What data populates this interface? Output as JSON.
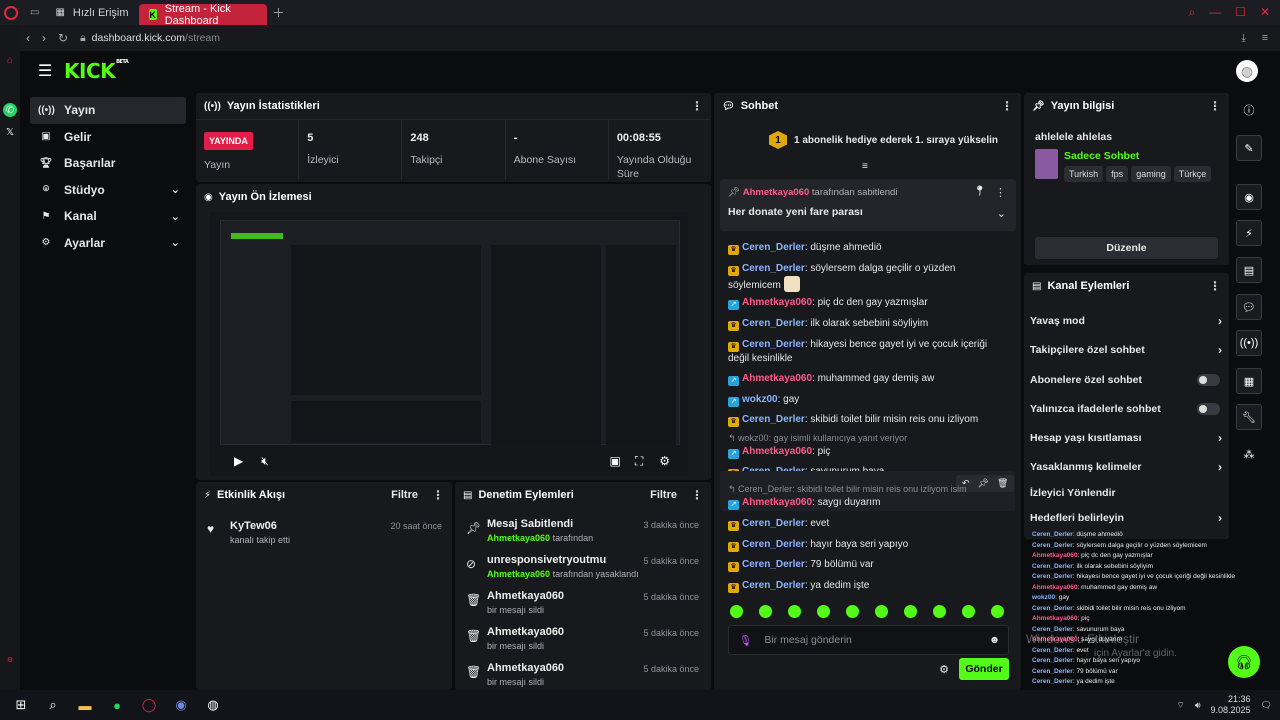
{
  "browser": {
    "tabs": [
      {
        "label": "Hızlı Erişim"
      },
      {
        "label": "Stream - Kick Dashboard"
      }
    ],
    "url_host": "dashboard.kick.com",
    "url_path": "/stream"
  },
  "header": {
    "logo": "KICK",
    "beta": "BETA"
  },
  "nav": [
    {
      "label": "Yayın",
      "icon": "broadcast-icon"
    },
    {
      "label": "Gelir",
      "icon": "wallet-icon"
    },
    {
      "label": "Başarılar",
      "icon": "trophy-icon"
    },
    {
      "label": "Stüdyo",
      "icon": "studio-icon"
    },
    {
      "label": "Kanal",
      "icon": "channel-icon"
    },
    {
      "label": "Ayarlar",
      "icon": "gear-icon"
    }
  ],
  "stats_panel": {
    "title": "Yayın İstatistikleri",
    "live_badge": "YAYINDA",
    "items": [
      {
        "label": "Yayın",
        "value": ""
      },
      {
        "label": "İzleyici",
        "value": "5"
      },
      {
        "label": "Takipçi",
        "value": "248"
      },
      {
        "label": "Abone Sayısı",
        "value": "-"
      },
      {
        "label": "Yayında Olduğu Süre",
        "value": "00:08:55"
      }
    ]
  },
  "preview_panel": {
    "title": "Yayın Ön İzlemesi"
  },
  "activity_panel": {
    "title": "Etkinlik Akışı",
    "filter": "Filtre",
    "events": [
      {
        "user": "KyTew06",
        "desc": "kanalı takip etti",
        "time": "20 saat önce"
      }
    ]
  },
  "moderation_panel": {
    "title": "Denetim Eylemleri",
    "filter": "Filtre",
    "items": [
      {
        "title": "Mesaj Sabitlendi",
        "actor": "Ahmetkaya060",
        "sub": "tarafından",
        "time": "3 dakika önce",
        "icon": "pin-icon"
      },
      {
        "title": "unresponsivetryoutmu",
        "actor": "Ahmetkaya060",
        "sub": "tarafından yasaklandı",
        "time": "5 dakika önce",
        "icon": "ban-icon"
      },
      {
        "title": "Ahmetkaya060",
        "actor": "",
        "sub": "bir mesajı sildi",
        "time": "5 dakika önce",
        "icon": "trash-icon"
      },
      {
        "title": "Ahmetkaya060",
        "actor": "",
        "sub": "bir mesajı sildi",
        "time": "5 dakika önce",
        "icon": "trash-icon"
      },
      {
        "title": "Ahmetkaya060",
        "actor": "",
        "sub": "bir mesajı sildi",
        "time": "5 dakika önce",
        "icon": "trash-icon"
      }
    ]
  },
  "chat_panel": {
    "title": "Sohbet",
    "gift_badge": "1",
    "gift_text": "1 abonelik hediye ederek 1. sıraya yükselin",
    "pinned": {
      "by": "Ahmetkaya060",
      "by_suffix": "tarafından sabitlendi",
      "text": "Her donate yeni fare parası"
    },
    "messages": [
      {
        "user": "Ceren_Derler",
        "badge": "crown",
        "text": ": düşme ahmediö"
      },
      {
        "user": "Ceren_Derler",
        "badge": "crown",
        "text": ": söylersem dalga geçilir o yüzden söylemicem"
      },
      {
        "user": "Ahmetkaya060",
        "badge": "arrow",
        "text": ": piç dc den gay yazmışlar"
      },
      {
        "user": "Ceren_Derler",
        "badge": "crown",
        "text": ": ilk olarak sebebini söyliyim"
      },
      {
        "user": "Ceren_Derler",
        "badge": "crown",
        "text": ": hikayesi bence gayet iyi ve çocuk içeriği değil kesinlikle"
      },
      {
        "user": "Ahmetkaya060",
        "badge": "arrow",
        "text": ": muhammed gay demiş aw"
      },
      {
        "user": "wokz00",
        "badge": "arrow",
        "text": ": gay"
      },
      {
        "user": "Ceren_Derler",
        "badge": "crown",
        "text": ": skibidi toilet bilir misin reis onu izliyom"
      },
      {
        "user": "Ahmetkaya060",
        "badge": "arrow",
        "text": ": piç"
      },
      {
        "user": "Ceren_Derler",
        "badge": "crown",
        "text": ": savunurum baya"
      },
      {
        "user": "Ahmetkaya060",
        "badge": "arrow",
        "text": ": saygı duyarım"
      },
      {
        "user": "Ceren_Derler",
        "badge": "crown",
        "text": ": evet"
      },
      {
        "user": "Ceren_Derler",
        "badge": "crown",
        "text": ": hayır baya seri yapıyo"
      },
      {
        "user": "Ceren_Derler",
        "badge": "crown",
        "text": ": 79 bölümü var"
      },
      {
        "user": "Ceren_Derler",
        "badge": "crown",
        "text": ": ya dedim işte"
      }
    ],
    "replies": [
      {
        "text": "wokz00: gay isimli kullanıcıya yanıt veriyor"
      },
      {
        "text": "Ceren_Derler: skibidi toilet bilir misin reis onu izliyom isim"
      }
    ],
    "placeholder": "Bir mesaj gönderin",
    "send": "Gönder"
  },
  "info_panel": {
    "title": "Yayın bilgisi",
    "stream_title": "ahlelele ahlelas",
    "category": "Sadece Sohbet",
    "tags": [
      "Turkish",
      "fps",
      "gaming",
      "Türkçe"
    ],
    "edit_button": "Düzenle"
  },
  "channel_actions": {
    "title": "Kanal Eylemleri",
    "items": [
      {
        "label": "Yavaş mod",
        "control": "chevron"
      },
      {
        "label": "Takipçilere özel sohbet",
        "control": "chevron"
      },
      {
        "label": "Abonelere özel sohbet",
        "control": "toggle"
      },
      {
        "label": "Yalınızca ifadelerle sohbet",
        "control": "toggle"
      },
      {
        "label": "Hesap yaşı kısıtlaması",
        "control": "chevron"
      },
      {
        "label": "Yasaklanmış kelimeler",
        "control": "chevron"
      },
      {
        "label": "İzleyici Yönlendir",
        "control": "none"
      },
      {
        "label": "Hedefleri belirleyin",
        "control": "chevron"
      }
    ]
  },
  "overlay_chat": [
    {
      "user": "Ceren_Derler",
      "text": ": düşme ahmediö"
    },
    {
      "user": "Ceren_Derler",
      "text": ": söylersem dalga geçilir o yüzden söylemicem"
    },
    {
      "user": "Ahmetkaya060",
      "text": ": piç dc den gay yazmışlar"
    },
    {
      "user": "Ceren_Derler",
      "text": ": ilk olarak sebebini söyliyim"
    },
    {
      "user": "Ceren_Derler",
      "text": ": hikayesi bence gayet iyi ve çocuk içeriği değil kesinlikle"
    },
    {
      "user": "Ahmetkaya060",
      "text": ": muhammed gay demiş aw"
    },
    {
      "user": "wokz00",
      "text": ": gay"
    },
    {
      "user": "Ceren_Derler",
      "text": ": skibidi toilet bilir misin reis onu izliyom"
    },
    {
      "user": "Ahmetkaya060",
      "text": ": piç"
    },
    {
      "user": "Ceren_Derler",
      "text": ": savunurum baya"
    },
    {
      "user": "Ahmetkaya060",
      "text": ": saygı duyarım"
    },
    {
      "user": "Ceren_Derler",
      "text": ": evet"
    },
    {
      "user": "Ceren_Derler",
      "text": ": hayır baya seri yapıyo"
    },
    {
      "user": "Ceren_Derler",
      "text": ": 79 bölümü var"
    },
    {
      "user": "Ceren_Derler",
      "text": ": ya dedim işte"
    }
  ],
  "windows": {
    "watermark1": "Windows'u Etkinleştir",
    "watermark2": "için Ayarlar'a gidin.",
    "time": "21:36",
    "date": "9.08.2025"
  },
  "colors": {
    "accent": "#53fc18",
    "live": "#e11d48",
    "opera": "#e3263d"
  }
}
